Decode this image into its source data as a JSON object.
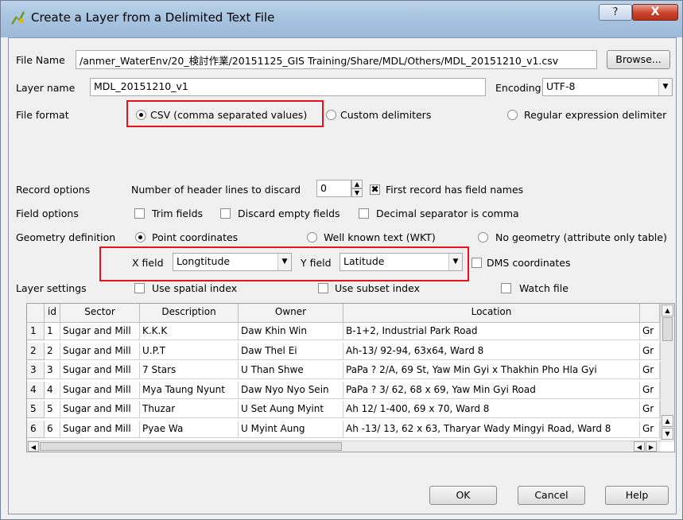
{
  "window": {
    "title": "Create a Layer from a Delimited Text File",
    "help_button": "?",
    "close_button": "X"
  },
  "file_name": {
    "label": "File Name",
    "value": "/anmer_WaterEnv/20_検討作業/20151125_GIS Training/Share/MDL/Others/MDL_20151210_v1.csv",
    "browse": "Browse..."
  },
  "layer_name": {
    "label": "Layer name",
    "value": "MDL_20151210_v1"
  },
  "encoding": {
    "label": "Encoding",
    "value": "UTF-8"
  },
  "file_format": {
    "label": "File format",
    "csv": "CSV (comma separated values)",
    "custom": "Custom delimiters",
    "regex": "Regular expression delimiter",
    "selected": "csv"
  },
  "record_options": {
    "label": "Record options",
    "header_label": "Number of header lines to discard",
    "header_value": "0",
    "first_record": "First record has field names"
  },
  "field_options": {
    "label": "Field options",
    "trim": "Trim fields",
    "discard": "Discard empty fields",
    "decimal": "Decimal separator is comma"
  },
  "geometry": {
    "label": "Geometry definition",
    "point": "Point coordinates",
    "wkt": "Well known text (WKT)",
    "none": "No geometry (attribute only table)",
    "x_label": "X field",
    "x_value": "Longtitude",
    "y_label": "Y field",
    "y_value": "Latitude",
    "dms": "DMS coordinates"
  },
  "layer_settings": {
    "label": "Layer settings",
    "spatial": "Use spatial index",
    "subset": "Use subset index",
    "watch": "Watch file"
  },
  "table": {
    "headers": [
      "id",
      "Sector",
      "Description",
      "Owner",
      "Location"
    ],
    "rows": [
      {
        "num": "1",
        "id": "1",
        "sector": "Sugar and Mill",
        "desc": "K.K.K",
        "owner": "Daw Khin Win",
        "loc": "B-1+2, Industrial Park Road",
        "extra": "Gr"
      },
      {
        "num": "2",
        "id": "2",
        "sector": "Sugar and Mill",
        "desc": "U.P.T",
        "owner": "Daw Thel Ei",
        "loc": "Ah-13/ 92-94, 63x64, Ward 8",
        "extra": "Gr"
      },
      {
        "num": "3",
        "id": "3",
        "sector": "Sugar and Mill",
        "desc": "7 Stars",
        "owner": "U Than Shwe",
        "loc": "PaPa ? 2/A, 69 St, Yaw Min Gyi x Thakhin Pho Hla Gyi",
        "extra": "Gr"
      },
      {
        "num": "4",
        "id": "4",
        "sector": "Sugar and Mill",
        "desc": "Mya Taung Nyunt",
        "owner": "Daw Nyo Nyo Sein",
        "loc": "PaPa ? 3/ 62, 68 x 69, Yaw Min Gyi Road",
        "extra": "Gr"
      },
      {
        "num": "5",
        "id": "5",
        "sector": "Sugar and Mill",
        "desc": "Thuzar",
        "owner": "U Set Aung Myint",
        "loc": "Ah 12/ 1-400, 69 x 70, Ward 8",
        "extra": "Gr"
      },
      {
        "num": "6",
        "id": "6",
        "sector": "Sugar and Mill",
        "desc": "Pyae Wa",
        "owner": "U Myint Aung",
        "loc": "Ah -13/ 13, 62 x 63, Tharyar Wady Mingyi Road, Ward 8",
        "extra": "Gr"
      }
    ]
  },
  "buttons": {
    "ok": "OK",
    "cancel": "Cancel",
    "help": "Help"
  }
}
